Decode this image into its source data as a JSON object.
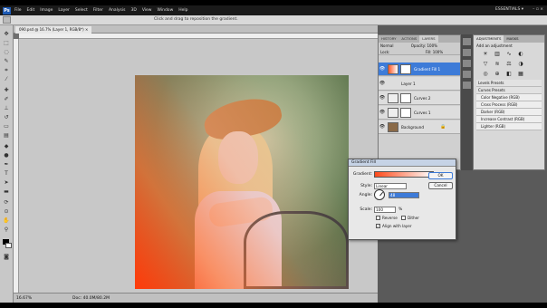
{
  "app": {
    "logo": "Ps",
    "menu": [
      "File",
      "Edit",
      "Image",
      "Layer",
      "Select",
      "Filter",
      "Analysis",
      "3D",
      "View",
      "Window",
      "Help"
    ],
    "workspace": "ESSENTIALS ▾",
    "window_controls": "– ▫ ×"
  },
  "options_bar": {
    "hint": "Click and drag to reposition the gradient."
  },
  "document": {
    "tab": "090.psd @ 16.7% (Layer 1, RGB/8*) ×"
  },
  "status": {
    "zoom": "16.67%",
    "doc": "Doc: 40.0M/80.2M"
  },
  "layers_panel": {
    "tabs": [
      "HISTORY",
      "ACTIONS",
      "LAYERS"
    ],
    "blend": "Normal",
    "opacity": "Opacity: 100%",
    "lock": "Lock:",
    "fill": "Fill: 100%",
    "layers": [
      {
        "name": "Gradient Fill 1",
        "selected": true
      },
      {
        "name": "Layer 1",
        "selected": false
      },
      {
        "name": "Curves 2",
        "selected": false
      },
      {
        "name": "Curves 1",
        "selected": false
      },
      {
        "name": "Background",
        "selected": false
      }
    ]
  },
  "adjustments_panel": {
    "tabs": [
      "ADJUSTMENTS",
      "MASKS"
    ],
    "title": "Add an adjustment",
    "presets": [
      "Levels Presets",
      "Curves Presets",
      "Color Negative (RGB)",
      "Cross Process (RGB)",
      "Darker (RGB)",
      "Increase Contrast (RGB)",
      "Lighter (RGB)"
    ]
  },
  "gradient_fill_dialog": {
    "title": "Gradient Fill",
    "gradient_label": "Gradient:",
    "style_label": "Style:",
    "style_value": "Linear",
    "angle_label": "Angle:",
    "angle_value": "48",
    "scale_label": "Scale:",
    "scale_value": "100",
    "percent": "%",
    "reverse": "Reverse",
    "dither": "Dither",
    "align": "Align with layer",
    "ok": "OK",
    "cancel": "Cancel"
  }
}
